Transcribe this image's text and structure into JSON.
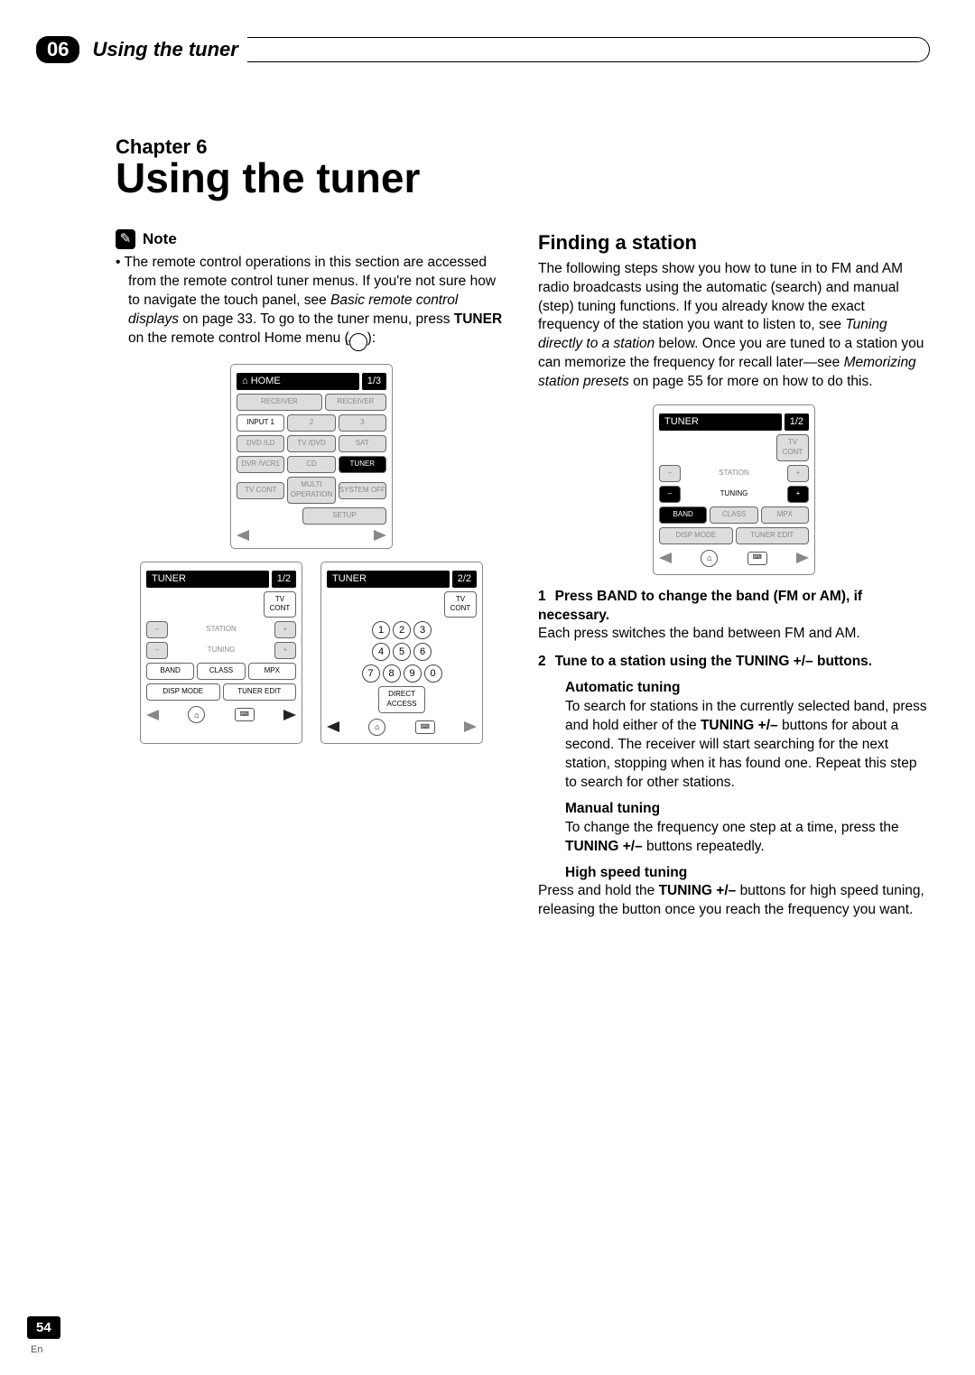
{
  "header": {
    "chapter_badge": "06",
    "header_title": "Using the tuner"
  },
  "chapter": {
    "prefix": "Chapter 6",
    "title": "Using the tuner"
  },
  "note": {
    "label": "Note",
    "body_1": "The remote control operations in this section are accessed from the remote control tuner menus. If you're not sure how to navigate the touch panel, see ",
    "body_italic_1": "Basic remote control displays",
    "body_2": " on page 33. To go to the tuner menu, press ",
    "body_bold_1": "TUNER",
    "body_3": " on the remote control Home menu (",
    "body_4": "):"
  },
  "finding": {
    "title": "Finding a station",
    "intro_1": "The following steps show you how to tune in to FM and AM radio broadcasts using the automatic (search) and manual (step) tuning functions. If you already know the exact frequency of the station you want to listen to, see ",
    "intro_italic_1": "Tuning directly to a station",
    "intro_2": " below. Once you are tuned to a station you can memorize the frequency for recall later—see ",
    "intro_italic_2": "Memorizing station presets",
    "intro_3": " on page 55 for more on how to do this.",
    "step1_num": "1",
    "step1_bold": "Press BAND to change the band (FM or AM), if necessary.",
    "step1_body": "Each press switches the band between FM and AM.",
    "step2_num": "2",
    "step2_bold": "Tune to a station using the TUNING +/– buttons.",
    "auto_head": "Automatic tuning",
    "auto_body_1": "To search for stations in the currently selected band, press and hold either of the ",
    "auto_bold": "TUNING +/–",
    "auto_body_2": " buttons for about a second. The receiver will start searching for the next station, stopping when it has found one. Repeat this step to search for other stations.",
    "manual_head": "Manual tuning",
    "manual_body_1": "To change the frequency one step at a time, press the ",
    "manual_bold": "TUNING +/–",
    "manual_body_2": " buttons repeatedly.",
    "high_head": "High speed tuning",
    "high_body_1": "Press and hold the ",
    "high_bold": "TUNING +/–",
    "high_body_2": " buttons for high speed tuning, releasing the button once you reach the frequency you want."
  },
  "remotes": {
    "home": {
      "title": "HOME",
      "page": "1/3",
      "receiver1": "RECEIVER",
      "receiver2": "RECEIVER",
      "input1": "INPUT 1",
      "n2": "2",
      "n3": "3",
      "dvd_ld": "DVD\n/LD",
      "tv_dvd": "TV\n/DVD",
      "sat": "SAT",
      "dvr_vcr1": "DVR\n/VCR1",
      "cd": "CD",
      "tuner": "TUNER",
      "tv_cont": "TV\nCONT",
      "multi_op": "MULTI\nOPERATION",
      "sys_off": "SYSTEM\nOFF",
      "setup": "SETUP"
    },
    "tuner12": {
      "title": "TUNER",
      "page": "1/2",
      "tv_cont": "TV\nCONT",
      "minus": "–",
      "plus": "+",
      "station": "STATION",
      "tuning": "TUNING",
      "band": "BAND",
      "class": "CLASS",
      "mpx": "MPX",
      "disp_mode": "DISP MODE",
      "tuner_edit": "TUNER EDIT"
    },
    "tuner22": {
      "title": "TUNER",
      "page": "2/2",
      "tv_cont": "TV\nCONT",
      "d1": "1",
      "d2": "2",
      "d3": "3",
      "d4": "4",
      "d5": "5",
      "d6": "6",
      "d7": "7",
      "d8": "8",
      "d9": "9",
      "d0": "0",
      "direct": "DIRECT\nACCESS"
    }
  },
  "footer": {
    "page": "54",
    "lang": "En"
  }
}
